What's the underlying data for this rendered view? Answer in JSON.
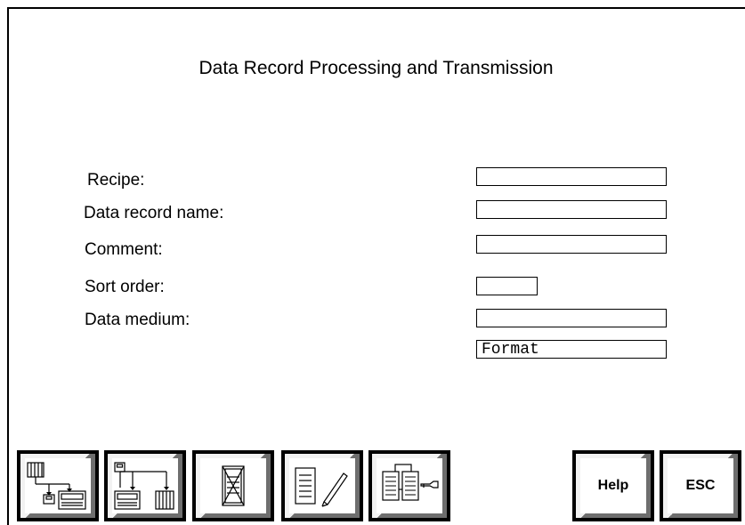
{
  "screen": {
    "title": "Data Record Processing and Transmission"
  },
  "form": {
    "recipe": {
      "label": "Recipe:",
      "value": ""
    },
    "data_record_name": {
      "label": "Data record name:",
      "value": ""
    },
    "comment": {
      "label": "Comment:",
      "value": ""
    },
    "sort_order": {
      "label": "Sort order:",
      "value": ""
    },
    "data_medium": {
      "label": "Data medium:",
      "value": ""
    },
    "format": {
      "value": "Format"
    }
  },
  "softkeys": [
    {
      "icon": "transfer-to-device-icon"
    },
    {
      "icon": "transfer-from-device-icon"
    },
    {
      "icon": "delete-record-icon"
    },
    {
      "icon": "edit-record-icon"
    },
    {
      "icon": "print-records-icon"
    },
    {
      "label": "Help"
    },
    {
      "label": "ESC"
    }
  ]
}
